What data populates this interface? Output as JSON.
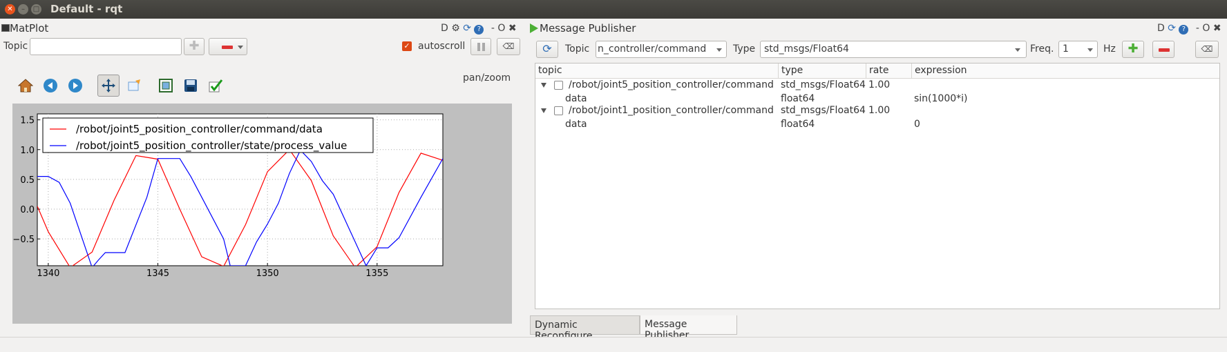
{
  "window": {
    "title": "Default - rqt"
  },
  "matplot": {
    "dock_title": "MatPlot",
    "dock_buttons": [
      "D",
      "O"
    ],
    "topic_label": "Topic",
    "topic_value": "",
    "autoscroll_label": "autoscroll",
    "autoscroll_checked": true,
    "mode_label": "pan/zoom",
    "toolbar_icons": [
      "home-icon",
      "back-icon",
      "forward-icon",
      "pan-icon",
      "zoom-icon",
      "subplots-icon",
      "save-icon",
      "edit-check-icon"
    ]
  },
  "publisher": {
    "dock_title": "Message Publisher",
    "dock_buttons": [
      "D",
      "O"
    ],
    "topic_label": "Topic",
    "topic_value": "n_controller/command",
    "type_label": "Type",
    "type_value": "std_msgs/Float64",
    "freq_label": "Freq.",
    "freq_value": "1",
    "hz_label": "Hz",
    "columns": [
      "topic",
      "type",
      "rate",
      "expression"
    ],
    "rows": [
      {
        "topic": "/robot/joint5_position_controller/command",
        "type": "std_msgs/Float64",
        "rate": "1.00",
        "expression": "",
        "child": {
          "name": "data",
          "type": "float64",
          "expression": "sin(1000*i)"
        }
      },
      {
        "topic": "/robot/joint1_position_controller/command",
        "type": "std_msgs/Float64",
        "rate": "1.00",
        "expression": "",
        "child": {
          "name": "data",
          "type": "float64",
          "expression": "0"
        }
      }
    ]
  },
  "tabs": [
    "Dynamic Reconfigure",
    "Message Publisher"
  ],
  "active_tab": "Message Publisher",
  "colors": {
    "red_series": "#ff0000",
    "blue_series": "#0000ff",
    "accent_orange": "#dd4814"
  },
  "chart_data": {
    "type": "line",
    "xlim": [
      1339.5,
      1358
    ],
    "ylim": [
      -0.95,
      1.6
    ],
    "xticks": [
      "1340",
      "1345",
      "1350",
      "1355"
    ],
    "yticks": [
      "1.5",
      "1.0",
      "0.5",
      "0.0",
      "−0.5"
    ],
    "legend_position": "top-left",
    "grid": true,
    "series": [
      {
        "name": "/robot/joint5_position_controller/command/data",
        "color": "#ff0000",
        "x": [
          1339.5,
          1340,
          1341,
          1342,
          1343,
          1344,
          1345,
          1346,
          1347,
          1348,
          1349,
          1350,
          1351,
          1352,
          1353,
          1354,
          1355,
          1356,
          1357,
          1358
        ],
        "y": [
          0.05,
          -0.38,
          -0.98,
          -0.72,
          0.15,
          0.9,
          0.84,
          0.0,
          -0.8,
          -0.96,
          -0.26,
          0.63,
          1.0,
          0.48,
          -0.45,
          -0.98,
          -0.63,
          0.28,
          0.94,
          0.82
        ]
      },
      {
        "name": "/robot/joint5_position_controller/state/process_value",
        "color": "#0000ff",
        "x": [
          1339.5,
          1340,
          1340.5,
          1341,
          1342,
          1342.3,
          1342.6,
          1343.5,
          1344.5,
          1345,
          1346,
          1346.5,
          1347,
          1348,
          1348.3,
          1349,
          1349.5,
          1350,
          1350.5,
          1351,
          1351.5,
          1352,
          1352.5,
          1353,
          1354,
          1354.5,
          1355,
          1355.5,
          1356,
          1357,
          1358
        ],
        "y": [
          0.55,
          0.55,
          0.45,
          0.1,
          -0.98,
          -0.85,
          -0.73,
          -0.73,
          0.2,
          0.85,
          0.85,
          0.55,
          0.2,
          -0.5,
          -0.95,
          -0.95,
          -0.55,
          -0.25,
          0.1,
          0.6,
          0.99,
          0.8,
          0.48,
          0.25,
          -0.55,
          -0.95,
          -0.65,
          -0.65,
          -0.48,
          0.2,
          0.85
        ]
      }
    ]
  }
}
